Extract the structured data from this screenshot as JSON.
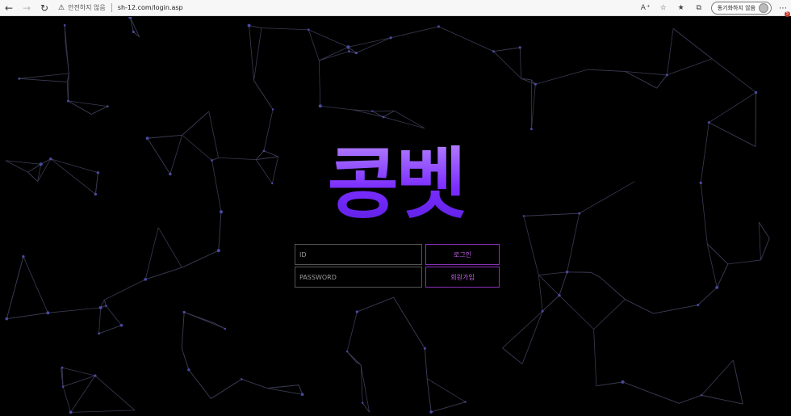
{
  "browser": {
    "security_warning": "안전하지 않음",
    "url": "sh-12.com/login.asp",
    "sync_label": "동기화하지 않음",
    "notification_count": "5"
  },
  "icons": {
    "back": "back-arrow-icon",
    "forward": "forward-arrow-icon",
    "reload": "reload-icon",
    "warning": "warning-icon",
    "read_aloud": "read-aloud-icon",
    "favorite": "favorite-star-icon",
    "collections": "collections-icon",
    "extensions": "extensions-icon",
    "more": "more-icon"
  },
  "logo": {
    "text": "콩벳"
  },
  "login": {
    "id_placeholder": "ID",
    "password_placeholder": "PASSWORD",
    "login_button": "로그인",
    "signup_button": "회원가입"
  },
  "colors": {
    "brand": "#7a2cff",
    "button_border": "#8a2fb8",
    "button_text": "#c25fe8"
  }
}
